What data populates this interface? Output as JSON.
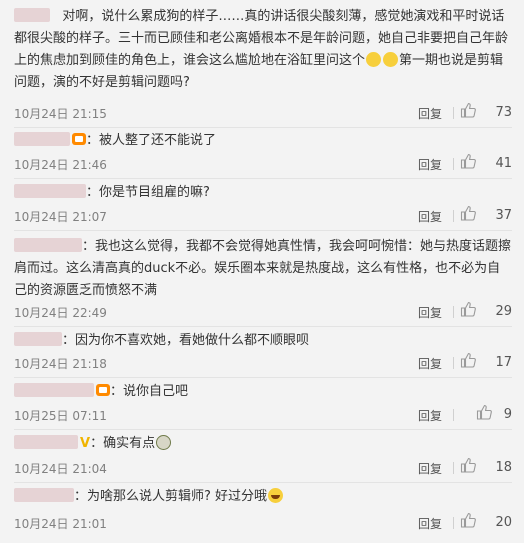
{
  "comments": [
    {
      "text": "对啊，说什么累成狗的样子……真的讲话很尖酸刻薄，感觉她演戏和平时说话都很尖酸的样子。三十而已顾佳和老公离婚根本不是年龄问题，她自己非要把自己年龄上的焦虑加到顾佳的角色上，谁会这么尴尬地在浴缸里问这个",
      "tail": "第一期也说是剪辑问题，演的不好是剪辑问题吗?",
      "date": "10月24日 21:15",
      "reply": "回复",
      "likes": "73"
    },
    {
      "text": "：被人整了还不能说了",
      "date": "10月24日 21:46",
      "reply": "回复",
      "likes": "41"
    },
    {
      "text": "：你是节目组雇的嘛?",
      "date": "10月24日 21:07",
      "reply": "回复",
      "likes": "37"
    },
    {
      "text": "：我也这么觉得，我都不会觉得她真性情，我会呵呵惋惜：她与热度话题擦肩而过。这么清高真的duck不必。娱乐圈本来就是热度战，这么有性格，也不必为自己的资源匮乏而愤怒不满",
      "date": "10月24日 22:49",
      "reply": "回复",
      "likes": "29"
    },
    {
      "text": "：因为你不喜欢她，看她做什么都不顺眼呗",
      "date": "10月24日 21:18",
      "reply": "回复",
      "likes": "17"
    },
    {
      "text": "：说你自己吧",
      "date": "10月25日 07:11",
      "reply": "回复",
      "likes": "9"
    },
    {
      "text": "：确实有点",
      "date": "10月24日 21:04",
      "reply": "回复",
      "likes": "18"
    },
    {
      "text": "：为啥那么说人剪辑师? 好过分哦",
      "date": "10月24日 21:01",
      "reply": "回复",
      "likes": "20"
    }
  ],
  "badges": {
    "vip": "V"
  },
  "icons": {
    "like": "thumbs-up-icon",
    "emoji": "emoji-icon"
  }
}
